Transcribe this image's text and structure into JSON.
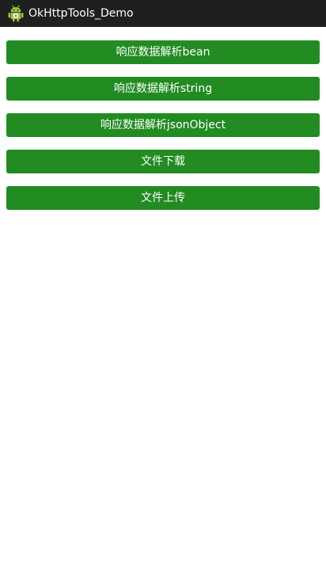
{
  "app": {
    "title": "OkHttpTools_Demo",
    "icon": "android-robot-icon"
  },
  "colors": {
    "action_bar": "#1f1f1f",
    "button": "#228b22",
    "button_text": "#ffffff",
    "background": "#ffffff"
  },
  "buttons": [
    {
      "label": "响应数据解析bean"
    },
    {
      "label": "响应数据解析string"
    },
    {
      "label": "响应数据解析jsonObject"
    },
    {
      "label": "文件下载"
    },
    {
      "label": "文件上传"
    }
  ]
}
